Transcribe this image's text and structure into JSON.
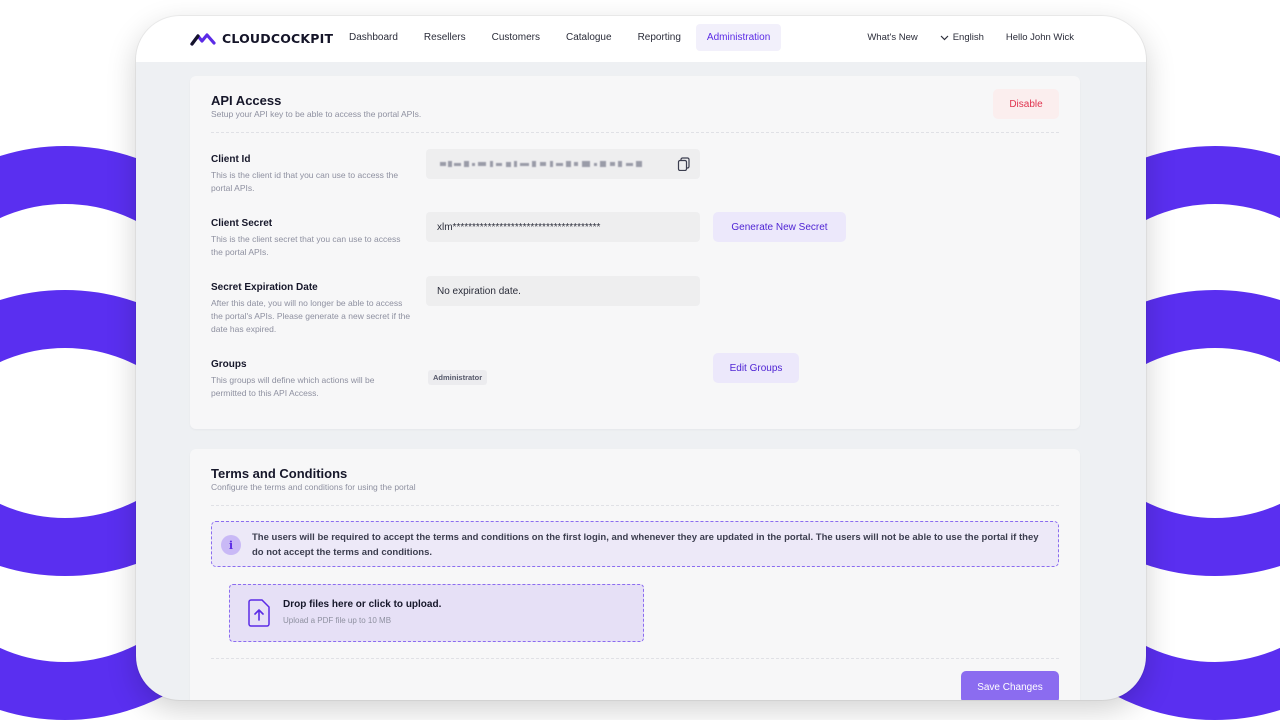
{
  "brand": {
    "name": "CLOUDCOCKPIT",
    "accent": "#5b2be6"
  },
  "nav": {
    "items": [
      {
        "label": "Dashboard"
      },
      {
        "label": "Resellers"
      },
      {
        "label": "Customers"
      },
      {
        "label": "Catalogue"
      },
      {
        "label": "Reporting"
      },
      {
        "label": "Administration",
        "active": true
      }
    ]
  },
  "topbar": {
    "whats_new": "What's New",
    "language": "English",
    "greeting": "Hello John Wick"
  },
  "api_access": {
    "title": "API Access",
    "subtitle": "Setup your API key to be able to access the portal APIs.",
    "disable_label": "Disable",
    "client_id": {
      "label": "Client Id",
      "description": "This is the client id that you can use to access the portal APIs.",
      "copy_icon": "copy-icon"
    },
    "client_secret": {
      "label": "Client Secret",
      "description": "This is the client secret that you can use to access the portal APIs.",
      "value": "xlm**************************************",
      "generate_label": "Generate New Secret"
    },
    "expiration": {
      "label": "Secret Expiration Date",
      "description": "After this date, you will no longer be able to access the portal's APIs. Please generate a new secret if the date has expired.",
      "value": "No expiration date."
    },
    "groups": {
      "label": "Groups",
      "description": "This groups will define which actions will be permitted to this API Access.",
      "chip": "Administrator",
      "edit_label": "Edit Groups"
    }
  },
  "terms": {
    "title": "Terms and Conditions",
    "subtitle": "Configure the terms and conditions for using the portal",
    "info": "The users will be required to accept the terms and conditions on the first login, and whenever they are updated in the portal. The users will not be able to use the portal if they do not accept the terms and conditions.",
    "upload_title": "Drop files here or click to upload.",
    "upload_sub": "Upload a PDF file up to 10 MB",
    "save_label": "Save Changes"
  }
}
